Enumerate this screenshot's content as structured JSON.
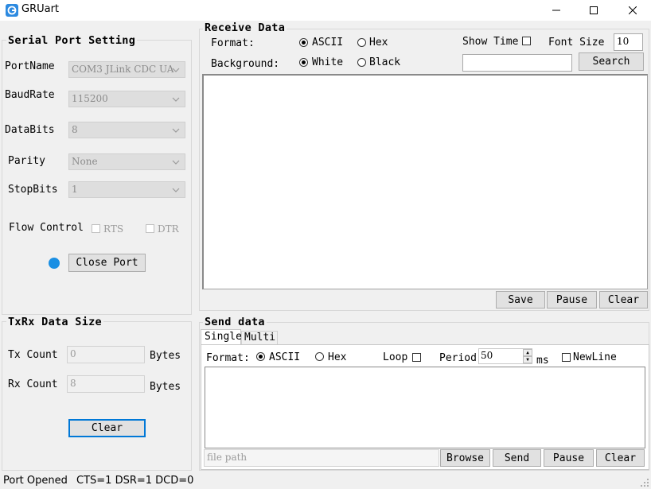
{
  "window": {
    "title": "GRUart",
    "icon": "app-logo-icon"
  },
  "serial": {
    "title": "Serial Port Setting",
    "fields": [
      {
        "label": "PortName",
        "value": "COM3 JLink CDC UA"
      },
      {
        "label": "BaudRate",
        "value": "115200"
      },
      {
        "label": "DataBits",
        "value": "8"
      },
      {
        "label": "Parity",
        "value": "None"
      },
      {
        "label": "StopBits",
        "value": "1"
      }
    ],
    "flow_label": "Flow Control",
    "rts_label": "RTS",
    "dtr_label": "DTR",
    "port_status_color": "#1a8fe3",
    "close_port_label": "Close Port"
  },
  "txrx": {
    "title": "TxRx Data Size",
    "tx_label": "Tx Count",
    "tx_value": "0",
    "rx_label": "Rx Count",
    "rx_value": "8",
    "bytes_label": "Bytes",
    "clear_label": "Clear"
  },
  "receive": {
    "title": "Receive Data",
    "format_label": "Format:",
    "format_options": [
      "ASCII",
      "Hex"
    ],
    "background_label": "Background:",
    "background_options": [
      "White",
      "Black"
    ],
    "show_time_label": "Show Time",
    "font_size_label": "Font Size",
    "font_size_value": "10",
    "search_value": "",
    "search_label": "Search",
    "save_label": "Save",
    "pause_label": "Pause",
    "clear_label": "Clear"
  },
  "send": {
    "title": "Send data",
    "tabs": [
      "Single",
      "Multi"
    ],
    "format_label": "Format:",
    "format_options": [
      "ASCII",
      "Hex"
    ],
    "loop_label": "Loop",
    "period_label": "Period",
    "period_value": "50",
    "ms_label": "ms",
    "newline_label": "NewLine",
    "file_path_placeholder": "file path",
    "browse_label": "Browse",
    "send_label": "Send",
    "pause_label": "Pause",
    "clear_label": "Clear"
  },
  "status": {
    "state": "Port Opened",
    "signals": "CTS=1 DSR=1 DCD=0"
  }
}
